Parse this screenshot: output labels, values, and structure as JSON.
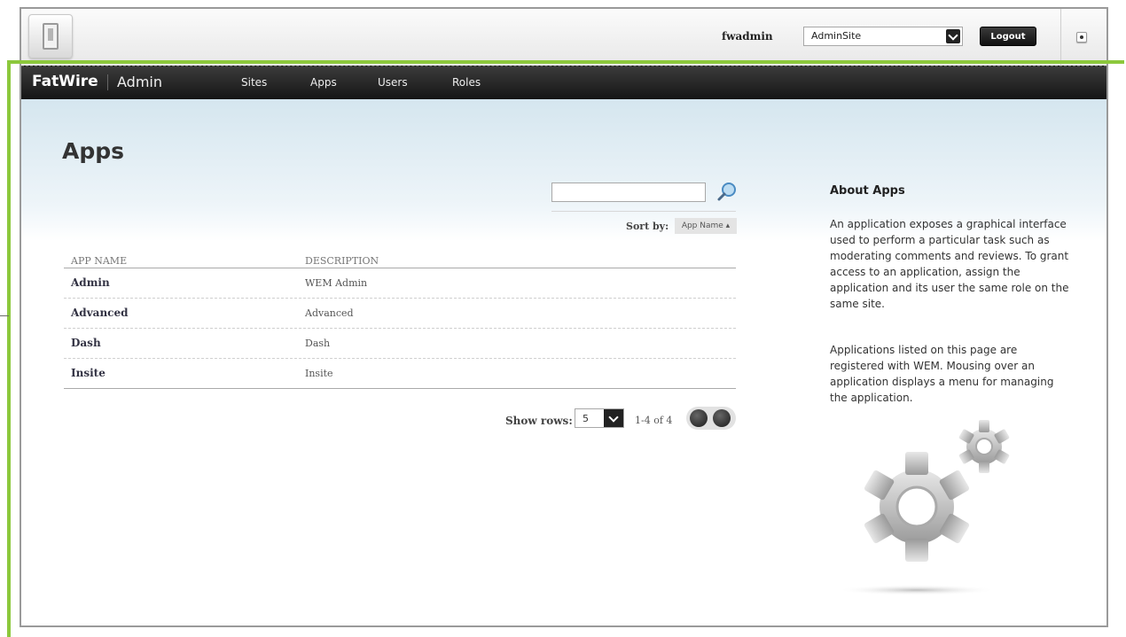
{
  "topbar": {
    "username": "fwadmin",
    "site_select": "AdminSite",
    "logout_label": "Logout"
  },
  "nav": {
    "brand": "FatWire",
    "brand_sub": "Admin",
    "items": [
      {
        "label": "Sites"
      },
      {
        "label": "Apps"
      },
      {
        "label": "Users"
      },
      {
        "label": "Roles"
      }
    ]
  },
  "page": {
    "title": "Apps",
    "search_value": "",
    "sort_label": "Sort by:",
    "sort_value": "App Name ▴"
  },
  "table": {
    "columns": [
      "APP NAME",
      "DESCRIPTION"
    ],
    "rows": [
      {
        "name": "Admin",
        "description": "WEM Admin"
      },
      {
        "name": "Advanced",
        "description": "Advanced"
      },
      {
        "name": "Dash",
        "description": "Dash"
      },
      {
        "name": "Insite",
        "description": "Insite"
      }
    ]
  },
  "pagination": {
    "show_rows_label": "Show rows:",
    "rows_value": "5",
    "info": "1-4 of 4"
  },
  "about": {
    "title": "About Apps",
    "paragraph1": "An application exposes a graphical interface used to perform a particular task such as moderating comments and reviews. To grant access to an application, assign the application and its user the same role on the same site.",
    "paragraph2": "Applications listed on this page are registered with WEM. Mousing over an application displays a menu for managing the application."
  },
  "colors": {
    "accent_green": "#8cc83c",
    "nav_dark": "#1f1f1f",
    "header_blue": "#d5e6ef"
  }
}
